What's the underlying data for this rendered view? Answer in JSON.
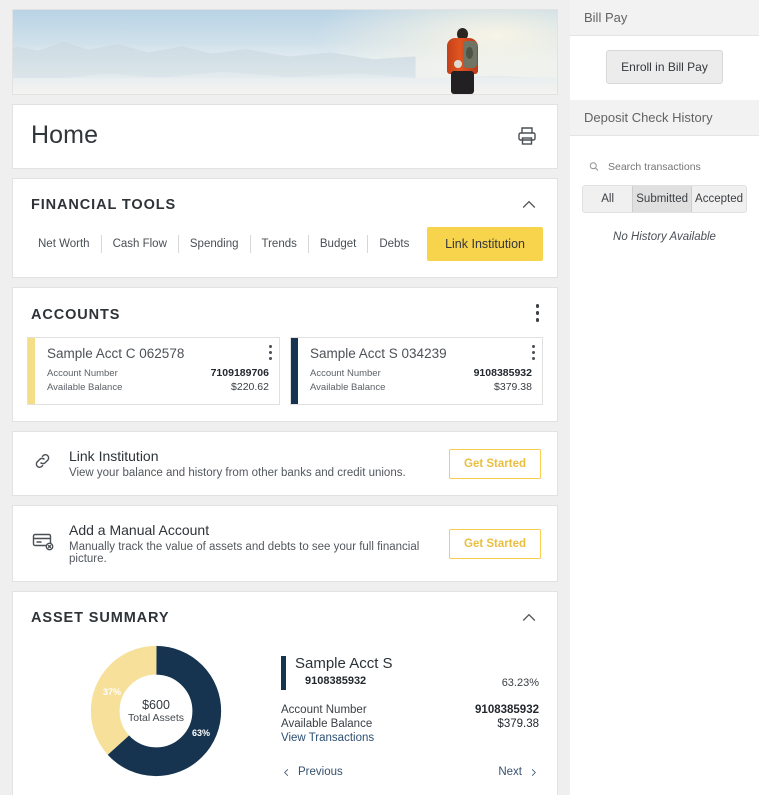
{
  "hero": {
    "alt": "hiker-on-mountain-summit-banner"
  },
  "header": {
    "title": "Home",
    "print_icon": "print-icon"
  },
  "financial_tools": {
    "title": "FINANCIAL TOOLS",
    "collapse_icon": "chevron-up-icon",
    "tabs": [
      {
        "label": "Net Worth"
      },
      {
        "label": "Cash Flow"
      },
      {
        "label": "Spending"
      },
      {
        "label": "Trends"
      },
      {
        "label": "Budget"
      },
      {
        "label": "Debts"
      }
    ],
    "link_button": "Link Institution"
  },
  "accounts": {
    "title": "ACCOUNTS",
    "menu_icon": "kebab-menu-icon",
    "label_account_number": "Account Number",
    "label_available_balance": "Available Balance",
    "items": [
      {
        "name": "Sample Acct C 062578",
        "account_number": "7109189706",
        "available_balance": "$220.62",
        "accent": "#f6dd8a"
      },
      {
        "name": "Sample Acct S 034239",
        "account_number": "9108385932",
        "available_balance": "$379.38",
        "accent": "#16344f"
      }
    ]
  },
  "promos": [
    {
      "icon": "link-chain-icon",
      "title": "Link Institution",
      "subtitle": "View your balance and history from other banks and credit unions.",
      "button": "Get Started"
    },
    {
      "icon": "manual-account-card-icon",
      "title": "Add a Manual Account",
      "subtitle": "Manually track the value of assets and debts to see your full financial picture.",
      "button": "Get Started"
    }
  ],
  "asset_summary": {
    "title": "ASSET SUMMARY",
    "collapse_icon": "chevron-up-icon",
    "center_amount": "$600",
    "center_caption": "Total Assets",
    "detail": {
      "name": "Sample Acct S",
      "number": "9108385932",
      "percent": "63.23%",
      "label_account_number": "Account Number",
      "value_account_number": "9108385932",
      "label_available_balance": "Available Balance",
      "value_available_balance": "$379.38",
      "view_transactions": "View Transactions"
    },
    "pager": {
      "previous": "Previous",
      "next": "Next"
    }
  },
  "chart_data": {
    "type": "pie",
    "title": "Asset Summary",
    "center_label": "$600 Total Assets",
    "total": 600,
    "categories": [
      "Sample Acct S 9108385932",
      "Sample Acct C 7109189706"
    ],
    "values": [
      63.23,
      36.77
    ],
    "value_labels": [
      "63%",
      "37%"
    ],
    "colors": [
      "#16344f",
      "#f6e09a"
    ],
    "donut": true,
    "legend": "right"
  },
  "sidebar": {
    "bill_pay": {
      "title": "Bill Pay",
      "enroll_button": "Enroll in Bill Pay"
    },
    "deposit_check": {
      "title": "Deposit Check History",
      "search_icon": "search-icon",
      "search_placeholder": "Search transactions",
      "filters": [
        {
          "label": "All",
          "active": false
        },
        {
          "label": "Submitted",
          "active": true
        },
        {
          "label": "Accepted",
          "active": false
        }
      ],
      "empty_message": "No History Available"
    }
  }
}
